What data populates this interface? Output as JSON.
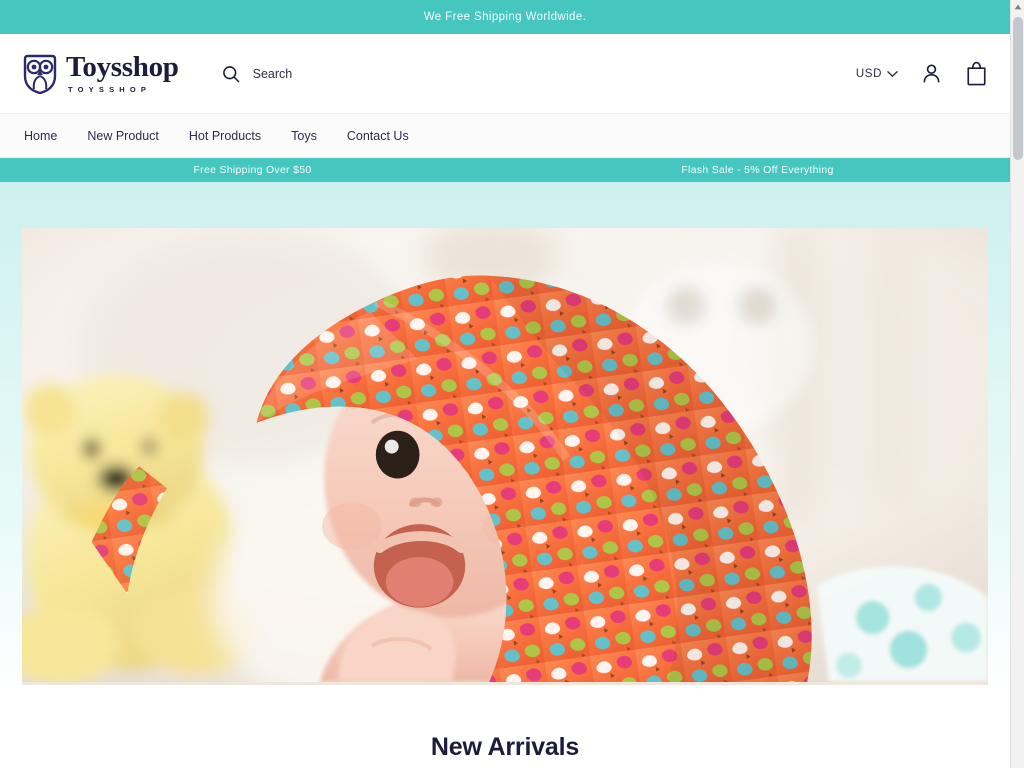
{
  "announcement": {
    "text": "We Free Shipping Worldwide."
  },
  "header": {
    "brand_name": "Toysshop",
    "brand_sub": "TOYSSHOP",
    "search_label": "Search",
    "search_placeholder": "Search",
    "currency": "USD",
    "icons": {
      "search": "search-icon",
      "chevron": "chevron-down-icon",
      "account": "account-person-icon",
      "cart": "shopping-bag-icon"
    }
  },
  "nav": {
    "items": [
      {
        "label": "Home"
      },
      {
        "label": "New Product"
      },
      {
        "label": "Hot Products"
      },
      {
        "label": "Toys"
      },
      {
        "label": "Contact Us"
      }
    ]
  },
  "promo": {
    "left": "Free Shipping Over $50",
    "right": "Flash Sale - 5% Off Everything"
  },
  "hero": {
    "alt": "Baby wearing an orange bird-patterned hooded towel beside a yellow teddy bear"
  },
  "section": {
    "title": "New Arrivals"
  },
  "colors": {
    "teal": "#45c7c0",
    "navy": "#1c1c3c",
    "hero_mint": "#ddf6f4",
    "towel_orange": "#f9733f"
  },
  "scrollbar": {
    "up_arrow": "scroll-up-arrow-icon"
  }
}
